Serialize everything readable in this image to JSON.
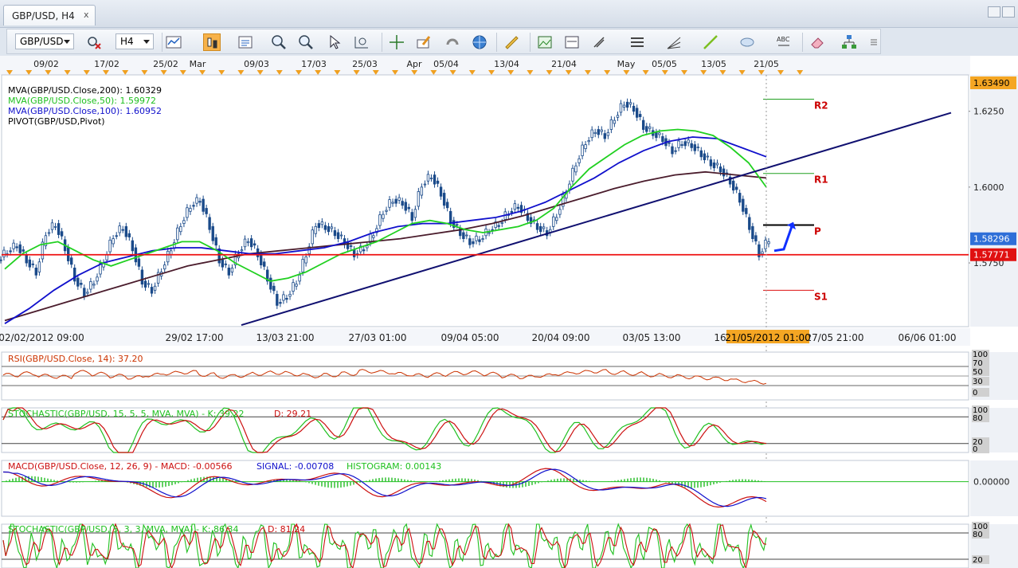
{
  "window": {
    "tab_title": "GBP/USD, H4",
    "close_glyph": "x"
  },
  "toolbar": {
    "symbol": "GBP/USD",
    "timeframe": "H4",
    "zoom_glyph": "ABC"
  },
  "chart_data": {
    "type": "candlestick",
    "symbol": "GBP/USD",
    "timeframe": "H4",
    "top_dates": [
      "09/02",
      "17/02",
      "25/02",
      "Mar",
      "09/03",
      "17/03",
      "25/03",
      "Apr",
      "05/04",
      "13/04",
      "21/04",
      "May",
      "05/05",
      "13/05",
      "21/05"
    ],
    "bottom_dates": [
      "02/02/2012 09:00",
      "29/02 17:00",
      "13/03 21:00",
      "27/03 01:00",
      "09/04 05:00",
      "20/04 09:00",
      "03/05 13:00",
      "16",
      "27/05 21:00",
      "06/06 01:00"
    ],
    "cursor_time": "21/05/2012 01:00",
    "price_axis": {
      "ticks": [
        "1.6250",
        "1.6000",
        "1.5750"
      ],
      "ylim": [
        1.554,
        1.637
      ]
    },
    "price_tags": {
      "high": "1.63490",
      "last": "1.58296",
      "pivot_line": "1.57771"
    },
    "indicators_legend": [
      {
        "text": "MVA(GBP/USD.Close,200): 1.60329",
        "color": "#000000"
      },
      {
        "text": "MVA(GBP/USD.Close,50): 1.59972",
        "color": "#20c020"
      },
      {
        "text": "MVA(GBP/USD.Close,100): 1.60952",
        "color": "#1010cc"
      },
      {
        "text": "PIVOT(GBP/USD,Pivot)",
        "color": "#000000"
      }
    ],
    "pivot_labels": {
      "r2": "R2",
      "r1": "R1",
      "p": "P",
      "s1": "S1"
    },
    "pivot_levels": {
      "r2": 1.629,
      "r1": 1.6045,
      "p": 1.5875,
      "s1": 1.566
    },
    "trendline": {
      "from": [
        0.25,
        1.5545
      ],
      "to": [
        0.99,
        1.6245
      ]
    },
    "series": {
      "close": [
        1.579,
        1.581,
        1.576,
        1.572,
        1.585,
        1.588,
        1.58,
        1.57,
        1.565,
        1.569,
        1.576,
        1.584,
        1.587,
        1.58,
        1.569,
        1.566,
        1.573,
        1.58,
        1.588,
        1.594,
        1.596,
        1.587,
        1.576,
        1.572,
        1.579,
        1.583,
        1.578,
        1.57,
        1.562,
        1.564,
        1.569,
        1.578,
        1.588,
        1.587,
        1.585,
        1.582,
        1.578,
        1.58,
        1.585,
        1.592,
        1.596,
        1.595,
        1.59,
        1.601,
        1.604,
        1.598,
        1.589,
        1.585,
        1.582,
        1.583,
        1.586,
        1.588,
        1.592,
        1.594,
        1.59,
        1.587,
        1.585,
        1.591,
        1.599,
        1.608,
        1.615,
        1.619,
        1.617,
        1.623,
        1.628,
        1.626,
        1.62,
        1.618,
        1.616,
        1.612,
        1.615,
        1.614,
        1.611,
        1.608,
        1.606,
        1.602,
        1.596,
        1.587,
        1.578,
        1.583
      ],
      "mva50": [
        1.573,
        1.578,
        1.581,
        1.582,
        1.579,
        1.576,
        1.574,
        1.576,
        1.578,
        1.58,
        1.582,
        1.582,
        1.579,
        1.575,
        1.572,
        1.569,
        1.57,
        1.572,
        1.575,
        1.578,
        1.58,
        1.582,
        1.585,
        1.588,
        1.589,
        1.588,
        1.586,
        1.585,
        1.586,
        1.587,
        1.589,
        1.593,
        1.6,
        1.606,
        1.61,
        1.614,
        1.617,
        1.6185,
        1.619,
        1.6185,
        1.617,
        1.613,
        1.608,
        1.6
      ],
      "mva100": [
        1.555,
        1.56,
        1.566,
        1.571,
        1.575,
        1.577,
        1.579,
        1.58,
        1.58,
        1.579,
        1.578,
        1.578,
        1.579,
        1.58,
        1.582,
        1.585,
        1.587,
        1.588,
        1.588,
        1.589,
        1.59,
        1.592,
        1.595,
        1.599,
        1.603,
        1.608,
        1.612,
        1.615,
        1.6165,
        1.616,
        1.613,
        1.61
      ],
      "mva200": [
        1.556,
        1.559,
        1.562,
        1.565,
        1.568,
        1.571,
        1.574,
        1.576,
        1.578,
        1.579,
        1.58,
        1.581,
        1.582,
        1.583,
        1.5845,
        1.586,
        1.588,
        1.5905,
        1.5935,
        1.5965,
        1.5995,
        1.602,
        1.604,
        1.605,
        1.604,
        1.603
      ]
    },
    "sub_panels": [
      {
        "name": "rsi",
        "label": "RSI(GBP/USD.Close, 14): 37.20",
        "color": "#cc3300",
        "levels": [
          "100",
          "70",
          "50",
          "30",
          "0"
        ],
        "values": [
          52,
          55,
          50,
          48,
          58,
          54,
          50,
          47,
          52,
          56,
          58,
          53,
          49,
          51,
          55,
          57,
          54,
          50,
          52,
          55,
          60,
          58,
          54,
          51,
          53,
          56,
          57,
          54,
          50,
          48,
          51,
          55,
          58,
          60,
          57,
          55,
          52,
          50,
          48,
          46,
          44,
          40,
          37
        ]
      },
      {
        "name": "stochastic-slow",
        "label_main": "STOCHASTIC(GBP/USD, 15, 5, 5, MVA, MVA) -  K: 39.22",
        "label_d": "D: 29.21",
        "levels": [
          "100",
          "80",
          "20",
          "0"
        ],
        "k": 39.22,
        "d": 29.21
      },
      {
        "name": "macd",
        "label_main": "MACD(GBP/USD.Close, 12, 26, 9) -  MACD: -0.00566",
        "label_signal": "SIGNAL: -0.00708",
        "label_hist": "HISTOGRAM: 0.00143",
        "levels": [
          "0.00000"
        ]
      },
      {
        "name": "stochastic-fast",
        "label_main": "STOCHASTIC(GBP/USD, 5, 3, 3, MVA, MVA) -  K: 86.34",
        "label_d": "D: 81.24",
        "levels": [
          "100",
          "80",
          "20"
        ],
        "k": 86.34,
        "d": 81.24
      }
    ]
  }
}
